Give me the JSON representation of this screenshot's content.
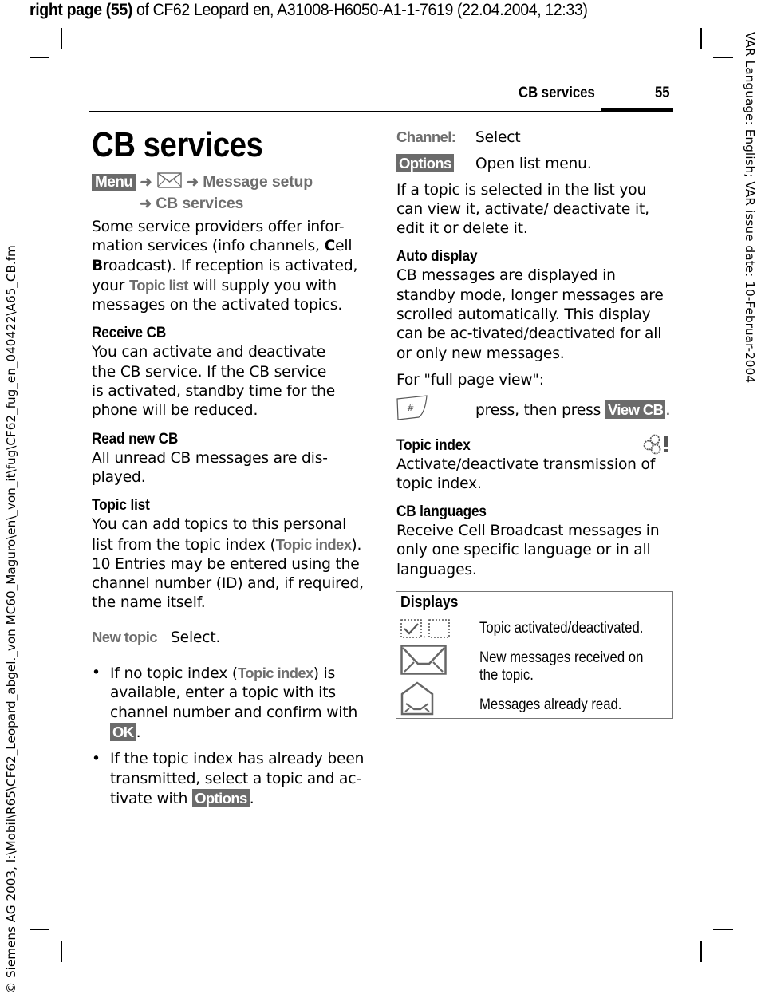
{
  "slug": {
    "bold_part": "right page (55)",
    "rest": " of CF62 Leopard en, A31008-H6050-A1-1-7619 (22.04.2004, 12:33)"
  },
  "side_left": "© Siemens AG 2003, I:\\Mobil\\R65\\CF62_Leopard_abgel._von MC60_Maguro\\en\\_von_it\\fug\\CF62_fug_en_040422\\A65_CB.fm",
  "side_right": "VAR Language: English; VAR issue date: 10-Februar-2004",
  "running_header": {
    "title": "CB services",
    "page_number": "55"
  },
  "left_column": {
    "title": "CB services",
    "menu_path": {
      "menu_key": "Menu",
      "arrow": "➜",
      "icon": "envelope-icon",
      "step1": "Message setup",
      "step2": "CB services"
    },
    "intro": {
      "t1": "Some service providers offer infor-mation services (info channels, ",
      "c": "C",
      "t2": "ell ",
      "b": "B",
      "t3": "roadcast). If reception is activated, your ",
      "link": "Topic list",
      "t4": " will supply you with messages on the activated topics."
    },
    "sections": [
      {
        "heading": "Receive CB",
        "text": "You can activate and deactivate the CB service. If the CB service is activated, standby time for the phone will be reduced."
      },
      {
        "heading": "Read new CB",
        "text": "All unread CB messages are dis-played."
      }
    ],
    "topic_list": {
      "heading": "Topic list",
      "t1": "You can add topics to this personal list from the topic index (",
      "link": "Topic index",
      "t2": "). 10 Entries may be entered using the channel number (ID) and, if required, the name itself."
    },
    "new_topic": {
      "label": "New topic",
      "text": "Select."
    },
    "bullets": [
      {
        "t1": "If no topic index (",
        "link": "Topic index",
        "t2": ") is available, enter a topic with its channel number and confirm with ",
        "key": "OK",
        "t3": "."
      },
      {
        "t1": "If the topic index has already been transmitted, select a topic and ac-tivate with ",
        "key": "Options",
        "t2": "."
      }
    ]
  },
  "right_column": {
    "channel": {
      "label": "Channel:",
      "text": "Select"
    },
    "options": {
      "key": "Options",
      "text": "Open list menu."
    },
    "selected_text": "If a topic is selected in the list you can view it, activate/ deactivate it, edit it or delete it.",
    "auto_display": {
      "heading": "Auto display",
      "text": "CB messages are displayed in standby mode, longer messages are scrolled automatically. This display can be ac-tivated/deactivated for all or only new messages."
    },
    "full_page": {
      "text": "For \"full page view\":",
      "hash_key_icon": "hash-key-icon",
      "hash_label": "#",
      "press_text": "press, then press ",
      "key": "View CB",
      "end": "."
    },
    "topic_index": {
      "heading": "Topic index",
      "icon": "network-service-icon",
      "text": "Activate/deactivate transmission of topic index."
    },
    "cb_languages": {
      "heading": "CB languages",
      "text": "Receive Cell Broadcast messages in only one specific language or in all languages."
    },
    "displays": {
      "title": "Displays",
      "rows": [
        {
          "icon": "checkbox-icons",
          "text": "Topic activated/deactivated."
        },
        {
          "icon": "envelope-closed-icon",
          "text_line1": "New messages received on",
          "text_line2": "the topic."
        },
        {
          "icon": "envelope-open-icon",
          "text": "Messages already read."
        }
      ]
    }
  },
  "colors": {
    "key_bg": "#6b6b6b",
    "link_gray": "#6e6e6e",
    "box_border": "#777777"
  }
}
